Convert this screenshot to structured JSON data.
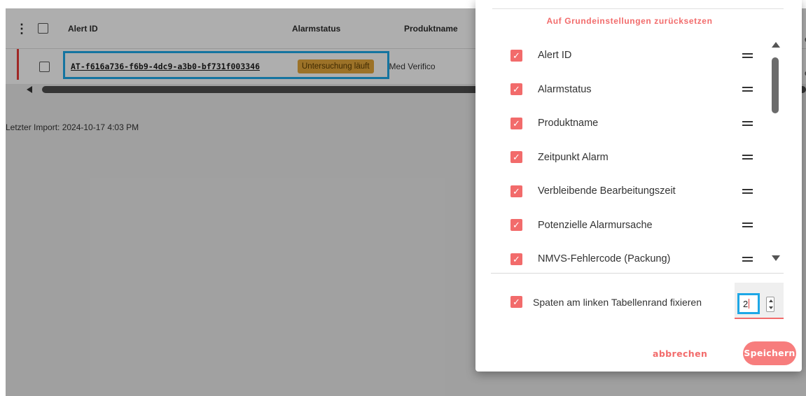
{
  "table": {
    "headers": {
      "alert_id": "Alert ID",
      "status": "Alarmstatus",
      "product": "Produktname"
    },
    "rows": [
      {
        "alert_id": "AT-f616a736-f6b9-4dc9-a3b0-bf731f003346",
        "status": "Untersuchung läuft",
        "product": "Med Verifico"
      }
    ],
    "last_import": "Letzter Import: 2024-10-17 4:03 PM"
  },
  "panel": {
    "reset_label": "Auf Grundeinstellungen zurücksetzen",
    "columns": [
      {
        "label": "Alert ID",
        "checked": true
      },
      {
        "label": "Alarmstatus",
        "checked": true
      },
      {
        "label": "Produktname",
        "checked": true
      },
      {
        "label": "Zeitpunkt Alarm",
        "checked": true
      },
      {
        "label": "Verbleibende Bearbeitungszeit",
        "checked": true
      },
      {
        "label": "Potenzielle Alarmursache",
        "checked": true
      },
      {
        "label": "NMVS-Fehlercode (Packung)",
        "checked": true
      }
    ],
    "fix_columns_label": "Spaten am linken Tabellenrand fixieren",
    "fix_columns_value": "2",
    "cancel_label": "abbrechen",
    "save_label": "Speichern"
  },
  "colors": {
    "accent": "#f26b6b",
    "highlight": "#1ea7e6",
    "badge": "#e0a43a"
  }
}
